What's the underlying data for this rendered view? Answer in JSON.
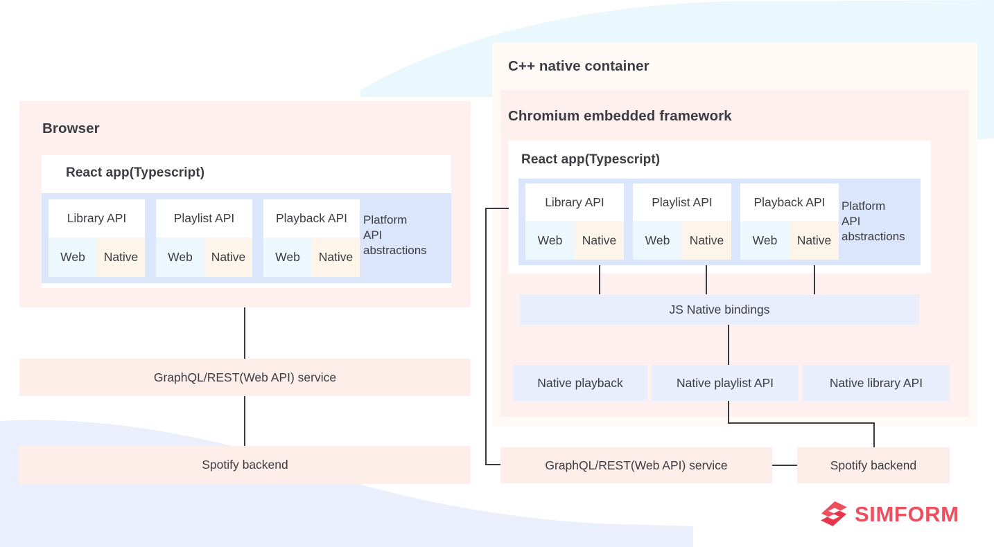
{
  "diagram": {
    "title_left": "Browser",
    "title_right": "C++ native container"
  },
  "left_panel": {
    "header": "Browser",
    "react_app": {
      "header": "React app(Typescript)",
      "platform_abstractions_label": "Platform API abstractions",
      "apis": [
        {
          "name": "Library API",
          "web": "Web",
          "native": "Native"
        },
        {
          "name": "Playlist API",
          "web": "Web",
          "native": "Native"
        },
        {
          "name": "Playback API",
          "web": "Web",
          "native": "Native"
        }
      ]
    },
    "service_box": "GraphQL/REST(Web API) service",
    "backend_box": "Spotify backend"
  },
  "right_panel": {
    "header": "C++ native container",
    "chromium": {
      "header": "Chromium embedded framework",
      "react_app": {
        "header": "React app(Typescript)",
        "platform_abstractions_label": "Platform API abstractions",
        "apis": [
          {
            "name": "Library API",
            "web": "Web",
            "native": "Native"
          },
          {
            "name": "Playlist API",
            "web": "Web",
            "native": "Native"
          },
          {
            "name": "Playback API",
            "web": "Web",
            "native": "Native"
          }
        ]
      },
      "bindings_box": "JS Native bindings",
      "native_boxes": [
        "Native playback",
        "Native playlist API",
        "Native library API"
      ]
    },
    "service_box": "GraphQL/REST(Web API) service",
    "backend_box": "Spotify backend"
  },
  "branding": {
    "logo_text": "SIMFORM",
    "logo_color": "#ee4f5f"
  },
  "colors": {
    "panel_pink": "#fdf0ee",
    "panel_cream": "#fffaf6",
    "panel_lavender": "#dbe5fb",
    "box_lavender": "#e8eefc",
    "box_pink": "#fdeeea",
    "cell_web": "#ecf8fd",
    "cell_native": "#fdf5ea",
    "text": "#3c3c43",
    "connector": "#3a3a3e",
    "bg_blue": "#eaf8fd",
    "bg_lavender": "#eaeffb"
  }
}
